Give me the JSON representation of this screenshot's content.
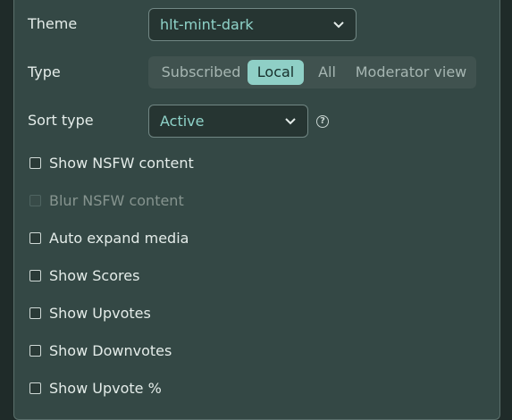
{
  "theme": {
    "label": "Theme",
    "value": "hlt-mint-dark"
  },
  "type": {
    "label": "Type",
    "options": [
      "Subscribed",
      "Local",
      "All",
      "Moderator view"
    ],
    "selected": "Local"
  },
  "sort": {
    "label": "Sort type",
    "value": "Active",
    "help": "?"
  },
  "checkboxes": [
    {
      "label": "Show NSFW content",
      "checked": false,
      "disabled": false
    },
    {
      "label": "Blur NSFW content",
      "checked": false,
      "disabled": true
    },
    {
      "label": "Auto expand media",
      "checked": false,
      "disabled": false
    },
    {
      "label": "Show Scores",
      "checked": false,
      "disabled": false
    },
    {
      "label": "Show Upvotes",
      "checked": false,
      "disabled": false
    },
    {
      "label": "Show Downvotes",
      "checked": false,
      "disabled": false
    },
    {
      "label": "Show Upvote %",
      "checked": false,
      "disabled": false
    }
  ],
  "colors": {
    "accent": "#8fcfc6",
    "panel": "#344845",
    "background": "#1f2b29"
  }
}
